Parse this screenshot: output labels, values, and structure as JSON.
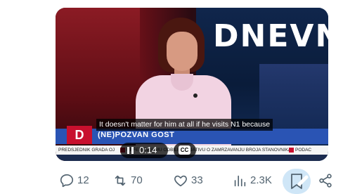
{
  "video": {
    "logo_text": "DNEVN",
    "channel_letter": "D",
    "guest_label": "(NE)POZVAN GOST",
    "caption": "It doesn't matter for him at all if he visits N1 because",
    "ticker": {
      "left": "PREDSJEDNIK GRADA OJ",
      "main": "REFERENDUMU ODBILI INICIJATIVU O ZAMRZAVANJU BROJA STANOVNIKA",
      "right": "PODAC"
    },
    "time": "0:14",
    "cc_label": "CC"
  },
  "actions": {
    "replies": "12",
    "reposts": "70",
    "likes": "33",
    "views": "2.3K"
  },
  "icons": [
    "pause-icon",
    "cc-icon",
    "reply-icon",
    "repost-icon",
    "like-icon",
    "views-icon",
    "bookmark-icon",
    "share-icon"
  ],
  "colors": {
    "accent_red": "#c8102e",
    "lower_third_blue": "#2a54b4",
    "action_gray": "#536471",
    "bookmark_highlight": "#cfe6f7"
  }
}
